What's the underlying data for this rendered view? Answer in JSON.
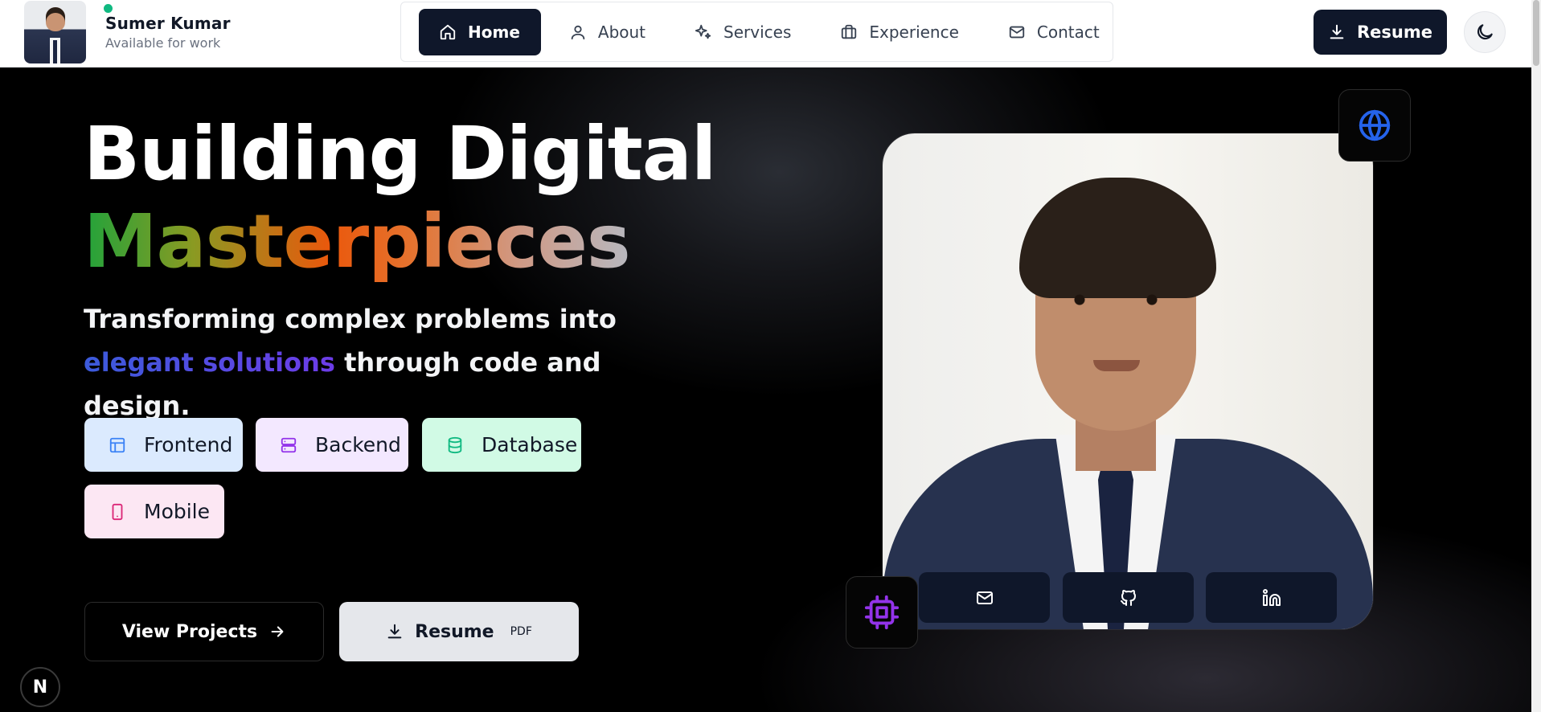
{
  "brand": {
    "name": "Sumer Kumar",
    "status": "Available for work"
  },
  "nav": {
    "items": [
      {
        "label": "Home",
        "icon": "home-icon",
        "active": true
      },
      {
        "label": "About",
        "icon": "user-icon",
        "active": false
      },
      {
        "label": "Services",
        "icon": "sparkles-icon",
        "active": false
      },
      {
        "label": "Experience",
        "icon": "briefcase-icon",
        "active": false
      },
      {
        "label": "Contact",
        "icon": "mail-icon",
        "active": false
      }
    ]
  },
  "header": {
    "resume_label": "Resume",
    "theme_icon": "moon-icon"
  },
  "hero": {
    "title_line1": "Building Digital",
    "title_line2": "Masterpieces",
    "tagline_part1": "Transforming complex problems into ",
    "tagline_highlight": "elegant solutions",
    "tagline_part2": " through code and design.",
    "chips": [
      {
        "label": "Frontend",
        "icon": "layout-icon",
        "color": "#dbeafe",
        "icon_color": "#3b82f6"
      },
      {
        "label": "Backend",
        "icon": "server-icon",
        "color": "#f3e8ff",
        "icon_color": "#9333ea"
      },
      {
        "label": "Database",
        "icon": "database-icon",
        "color": "#d1fae5",
        "icon_color": "#10b981"
      },
      {
        "label": "Mobile",
        "icon": "smartphone-icon",
        "color": "#fce7f3",
        "icon_color": "#db2777"
      }
    ],
    "cta_projects": "View Projects",
    "cta_resume": "Resume",
    "cta_resume_tag": "PDF"
  },
  "badge": {
    "next_letter": "N"
  },
  "colors": {
    "accent_dark": "#0f172a",
    "online": "#10b981",
    "globe": "#2563eb",
    "cpu": "#9333ea"
  }
}
